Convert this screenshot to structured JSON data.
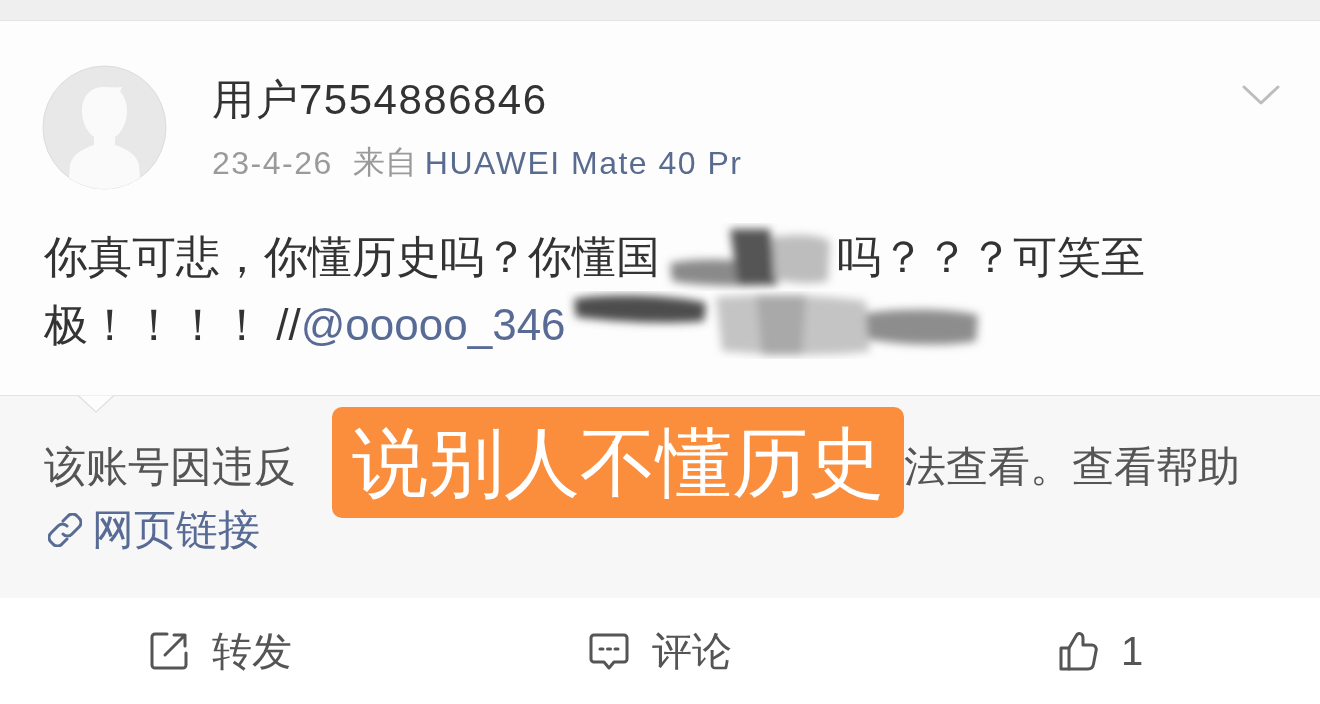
{
  "header": {
    "username": "用户7554886846",
    "date": "23-4-26",
    "source_label": "来自",
    "source": "HUAWEI Mate 40 Pr"
  },
  "post": {
    "lines": [
      [
        {
          "kind": "text",
          "text": "你真可悲，你懂历史吗？你懂国"
        },
        {
          "kind": "redacted"
        },
        {
          "kind": "text",
          "text": "吗？？？可笑至"
        }
      ],
      [
        {
          "kind": "text",
          "text": "极！！！！ //"
        },
        {
          "kind": "mention",
          "text": "@ooooo_346"
        },
        {
          "kind": "redacted"
        }
      ]
    ]
  },
  "retweet": {
    "notice_before": "该账号因违反",
    "annotation_label": "说别人不懂历史",
    "notice_after": "法查看。查看帮助",
    "link": "网页链接"
  },
  "actions": [
    {
      "kind": "repost",
      "label": "转发"
    },
    {
      "kind": "comment",
      "label": "评论"
    },
    {
      "kind": "like",
      "label": "1"
    }
  ]
}
